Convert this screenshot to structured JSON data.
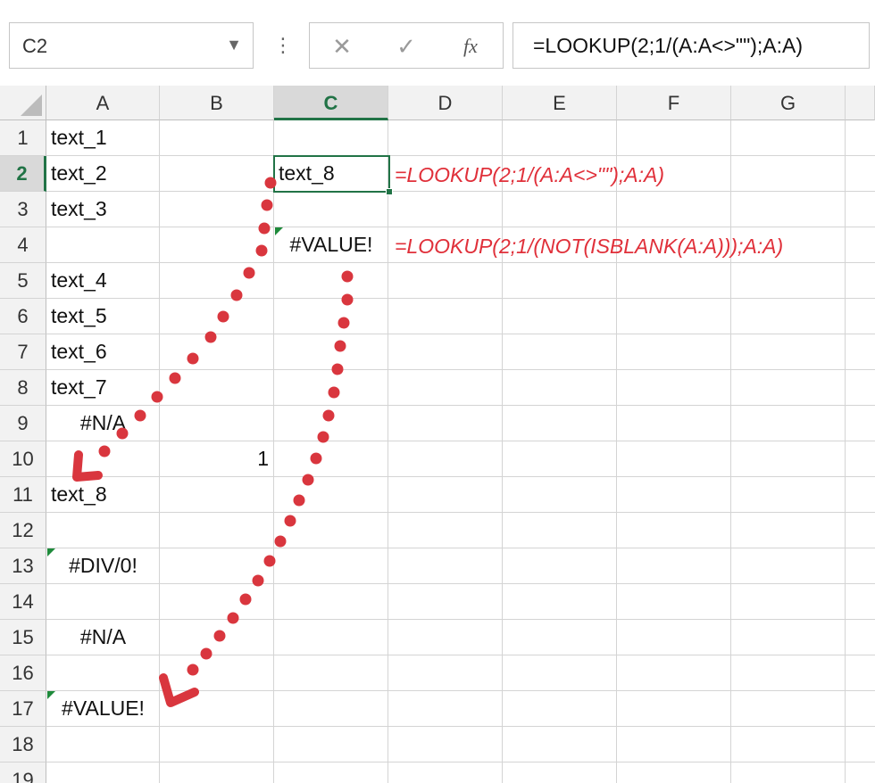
{
  "name_box": {
    "value": "C2",
    "dropdown_icon": "▼"
  },
  "toolbar": {
    "more_icon": "⋮",
    "cancel_icon": "✕",
    "enter_icon": "✓",
    "fx_icon": "fx"
  },
  "formula_bar": {
    "value": "=LOOKUP(2;1/(A:A<>\"\");A:A)"
  },
  "columns": [
    "A",
    "B",
    "C",
    "D",
    "E",
    "F",
    "G"
  ],
  "active_column": "C",
  "rows": [
    "1",
    "2",
    "3",
    "4",
    "5",
    "6",
    "7",
    "8",
    "9",
    "10",
    "11",
    "12",
    "13",
    "14",
    "15",
    "16",
    "17",
    "18",
    "19"
  ],
  "active_row": "2",
  "cells": {
    "A1": "text_1",
    "A2": "text_2",
    "A3": "text_3",
    "A5": "text_4",
    "A6": "text_5",
    "A7": "text_6",
    "A8": "text_7",
    "A9": "#N/A",
    "B10": "1",
    "A11": "text_8",
    "A13": "#DIV/0!",
    "A15": "#N/A",
    "A17": "#VALUE!",
    "C2": "text_8",
    "C4": "#VALUE!"
  },
  "annotations": {
    "row2": "=LOOKUP(2;1/(A:A<>\"\");A:A)",
    "row4": "=LOOKUP(2;1/(NOT(ISBLANK(A:A)));A:A)"
  },
  "colors": {
    "accent": "#217346",
    "annotation": "#e0303a",
    "error_marker": "#1e8a3b",
    "dots": "#d9363e"
  }
}
